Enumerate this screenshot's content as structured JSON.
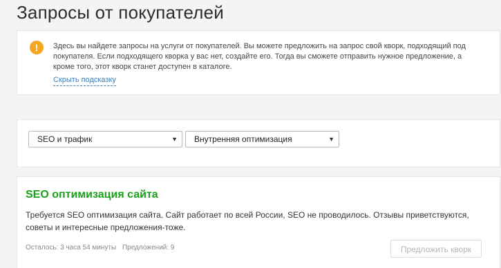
{
  "page": {
    "title": "Запросы от покупателей"
  },
  "hint": {
    "icon": "exclamation-icon",
    "icon_glyph": "!",
    "icon_color": "#f5a623",
    "text": "Здесь вы найдете запросы на услуги от покупателей. Вы можете предложить на запрос свой кворк, подходящий под покупателя. Если подходящего кворка у вас нет, создайте его. Тогда вы сможете отправить нужное предложение, а кроме того, этот кворк станет доступен в каталоге.",
    "hide_link": "Скрыть подсказку"
  },
  "filters": {
    "category": {
      "selected": "SEO и трафик",
      "arrow": "▼"
    },
    "subcategory": {
      "selected": "Внутренняя оптимизация",
      "arrow": "▼"
    }
  },
  "requests": [
    {
      "title": "SEO оптимизация сайта",
      "title_color": "#1aa01a",
      "description": "Требуется SEO оптимизация сайта. Сайт работает по всей России, SEO не проводилось. Отзывы приветствуются, советы и интересные предложения-тоже.",
      "time_left": "Осталось: 3 часа 54 минуты",
      "offers": "Предложений: 9",
      "offer_button": "Предложить кворк"
    }
  ]
}
